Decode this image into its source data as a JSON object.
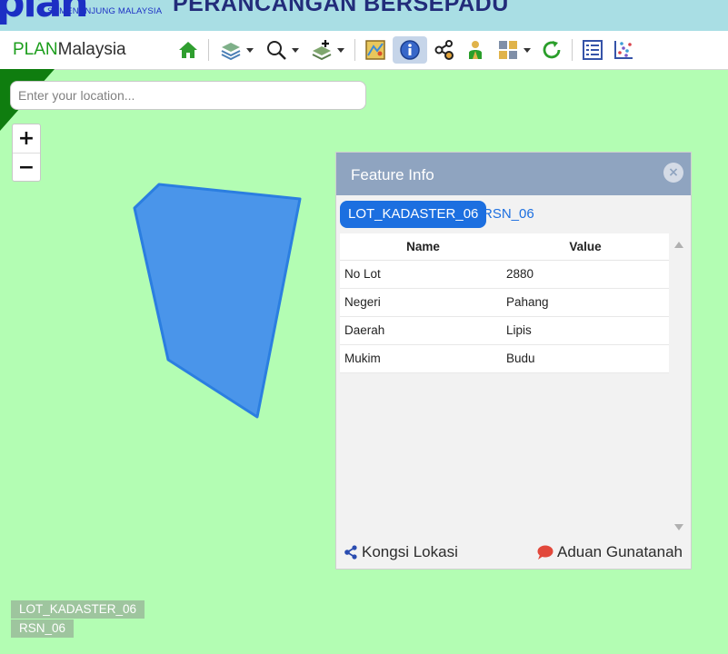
{
  "banner": {
    "logo_text": "plan",
    "logo_subtitle": "SEMENANJUNG MALAYSIA",
    "title": "PERANCANGAN BERSEPADU"
  },
  "toolbar": {
    "brand_accent": "PLAN",
    "brand_rest": "Malaysia",
    "tools": [
      {
        "name": "home-icon",
        "dropdown": false
      },
      {
        "name": "layers-icon",
        "dropdown": true
      },
      {
        "name": "search-zoom-icon",
        "dropdown": true
      },
      {
        "name": "add-layer-icon",
        "dropdown": true
      },
      {
        "name": "map-icon",
        "dropdown": false
      },
      {
        "name": "info-icon",
        "dropdown": false,
        "active": true
      },
      {
        "name": "network-icon",
        "dropdown": false
      },
      {
        "name": "person-icon",
        "dropdown": false
      },
      {
        "name": "grid-icon",
        "dropdown": true
      },
      {
        "name": "refresh-icon",
        "dropdown": false
      },
      {
        "name": "list-icon",
        "dropdown": false
      },
      {
        "name": "chart-icon",
        "dropdown": false
      }
    ]
  },
  "search": {
    "placeholder": "Enter your location..."
  },
  "zoom": {
    "in_label": "+",
    "out_label": "−"
  },
  "feature_info": {
    "title": "Feature Info",
    "close_label": "×",
    "tabs": [
      {
        "label": "LOT_KADASTER_06",
        "active": true
      },
      {
        "label": "RSN_06",
        "active": false
      }
    ],
    "columns": [
      "Name",
      "Value"
    ],
    "rows": [
      [
        "No Lot",
        "2880"
      ],
      [
        "Negeri",
        "Pahang"
      ],
      [
        "Daerah",
        "Lipis"
      ],
      [
        "Mukim",
        "Budu"
      ]
    ],
    "share_label": "Kongsi Lokasi",
    "report_label": "Aduan Gunatanah"
  },
  "legend": {
    "items": [
      "LOT_KADASTER_06",
      "RSN_06"
    ]
  },
  "colors": {
    "map_background": "#b3fdb3",
    "polygon_fill": "#4a95ea",
    "tab_active": "#1c6fe0",
    "panel_header": "#8fa4c0",
    "brand_green": "#1c9e1c"
  }
}
